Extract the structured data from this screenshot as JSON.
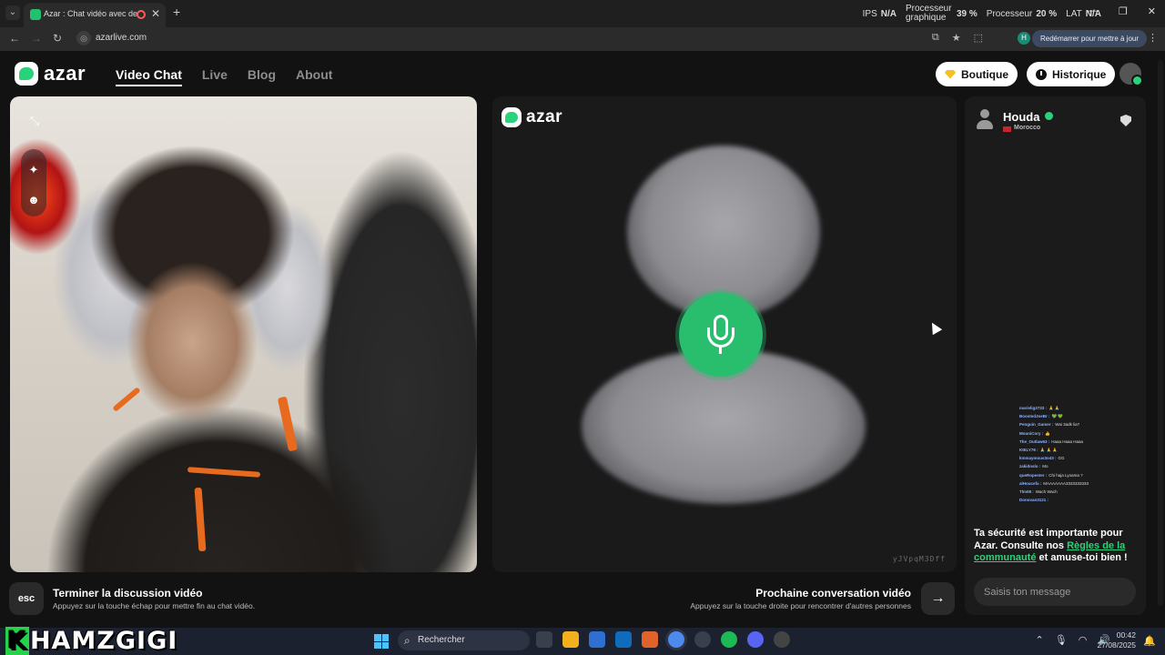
{
  "browser": {
    "tab_title": "Azar : Chat vidéo avec de n",
    "url": "azarlive.com",
    "restart_label": "Redémarrer pour mettre à jour",
    "profile_initial": "H",
    "stats": [
      {
        "label": "IPS",
        "value": "N/A"
      },
      {
        "label": "Processeur graphique",
        "value": "39 %"
      },
      {
        "label": "Processeur",
        "value": "20 %"
      },
      {
        "label": "LAT",
        "value": "N/A"
      }
    ]
  },
  "site": {
    "logo_text": "azar",
    "nav": [
      {
        "label": "Video Chat",
        "active": true
      },
      {
        "label": "Live",
        "active": false
      },
      {
        "label": "Blog",
        "active": false
      },
      {
        "label": "About",
        "active": false
      }
    ],
    "shop_label": "Boutique",
    "history_label": "Historique"
  },
  "partner": {
    "name": "Houda",
    "country": "Morocco",
    "video_id": "yJVpqM3Dff"
  },
  "twitch_chat": [
    {
      "user": "marielig2733 :",
      "text": "🙏 🙏"
    },
    {
      "user": "BoostedJoeBr :",
      "text": "💚 💚"
    },
    {
      "user": "Penguin_Gamer :",
      "text": "Wai 3adk lia?"
    },
    {
      "user": "MouniCory :",
      "text": "👍"
    },
    {
      "user": "The_Outlaw63 :",
      "text": "Haaa Haaa Haaa"
    },
    {
      "user": "KIELY76 :",
      "text": "🙏 🙏 🙏"
    },
    {
      "user": "kmmaymous3o43 :",
      "text": "GG"
    },
    {
      "user": "zakidoslo :",
      "text": "Mo"
    },
    {
      "user": "queRopester :",
      "text": "Chi haja Lyoama ?"
    },
    {
      "user": "alHoucefa :",
      "text": "MAAAAAAA3333333333"
    },
    {
      "user": "Tlm08 :",
      "text": "Wach Wach"
    },
    {
      "user": "Donovan3121 :",
      "text": ""
    }
  ],
  "chat": {
    "safety_pre": "Ta sécurité est importante pour Azar. Consulte nos ",
    "safety_link": "Règles de la communauté",
    "safety_post": " et amuse-toi bien !",
    "input_placeholder": "Saisis ton message"
  },
  "actions": {
    "esc_key": "esc",
    "end_title": "Terminer la discussion vidéo",
    "end_sub": "Appuyez sur la touche échap pour mettre fin au chat vidéo.",
    "next_title": "Prochaine conversation vidéo",
    "next_sub": "Appuyez sur la touche droite pour rencontrer d'autres personnes"
  },
  "taskbar": {
    "watermark": "KHAMZGIGI",
    "search_label": "Rechercher",
    "time": "00:42",
    "date": "27/08/2025"
  },
  "colors": {
    "brand_green": "#2bd27c",
    "mic_green": "#29bd6e"
  }
}
